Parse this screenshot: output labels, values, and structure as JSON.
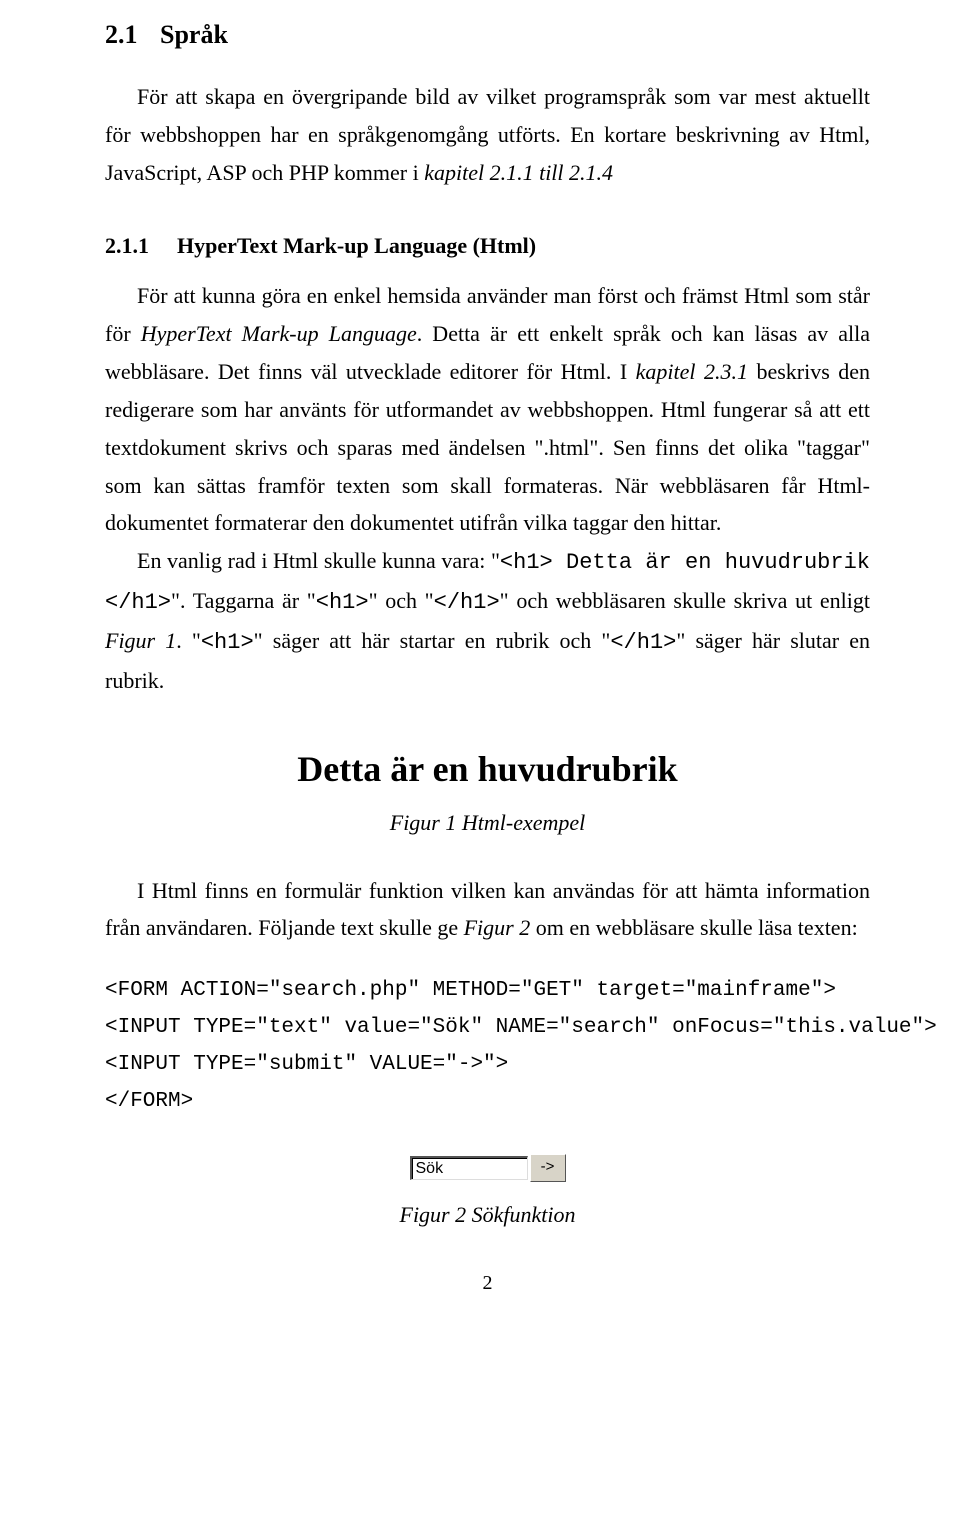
{
  "section": {
    "num": "2.1",
    "title": "Språk"
  },
  "para1_a": "För att skapa en övergripande bild av vilket programspråk som var mest aktuellt för webbshoppen har en språkgenomgång utförts. En kortare beskrivning av Html, JavaScript, ASP och PHP kommer i ",
  "para1_ital": "kapitel 2.1.1 till 2.1.4",
  "subsection": {
    "num": "2.1.1",
    "title": "HyperText Mark-up Language (Html)"
  },
  "para2_seg1": "För att kunna göra en enkel hemsida använder man först och främst Html som står för ",
  "para2_ital1": "HyperText Mark-up Language",
  "para2_seg2": ". Detta är ett enkelt språk och kan läsas av alla webbläsare. Det finns väl utvecklade editorer för Html. I ",
  "para2_ital2": "kapitel 2.3.1",
  "para2_seg3": " beskrivs den redigerare som har använts för utformandet av webbshoppen. Html fungerar så att ett textdokument skrivs och sparas med ändelsen \".html\". Sen finns det olika \"taggar\" som kan sättas framför texten som skall formateras. När webbläsaren får Html-dokumentet formaterar den dokumentet utifrån vilka taggar den hittar.",
  "para3_seg1": "En vanlig rad i Html skulle kunna vara: \"",
  "para3_code1": "<h1> Detta är en huvudrubrik </h1>",
  "para3_seg2": "\". Taggarna är \"",
  "para3_code2": "<h1>",
  "para3_seg3": "\" och \"",
  "para3_code3": "</h1>",
  "para3_seg4": "\" och webbläsaren skulle skriva ut enligt ",
  "para3_ital1": "Figur 1",
  "para3_seg5": ". \"",
  "para3_code4": "<h1>",
  "para3_seg6": "\" säger att här startar en rubrik och \"",
  "para3_code5": "</h1>",
  "para3_seg7": "\" säger här slutar en rubrik.",
  "figure1_headline": "Detta är en huvudrubrik",
  "figure1_caption": "Figur 1 Html-exempel",
  "para4_seg1": "I Html finns en formulär funktion vilken kan användas för att hämta information från användaren. Följande text skulle ge ",
  "para4_ital1": "Figur 2",
  "para4_seg2": " om en webbläsare skulle läsa texten:",
  "code_block": "<FORM ACTION=\"search.php\" METHOD=\"GET\" target=\"mainframe\">\n<INPUT TYPE=\"text\" value=\"Sök\" NAME=\"search\" onFocus=\"this.value\">\n<INPUT TYPE=\"submit\" VALUE=\"->\">\n</FORM>",
  "figure2_input_value": "Sök",
  "figure2_button_label": "->",
  "figure2_caption": "Figur 2 Sökfunktion",
  "page_number": "2"
}
